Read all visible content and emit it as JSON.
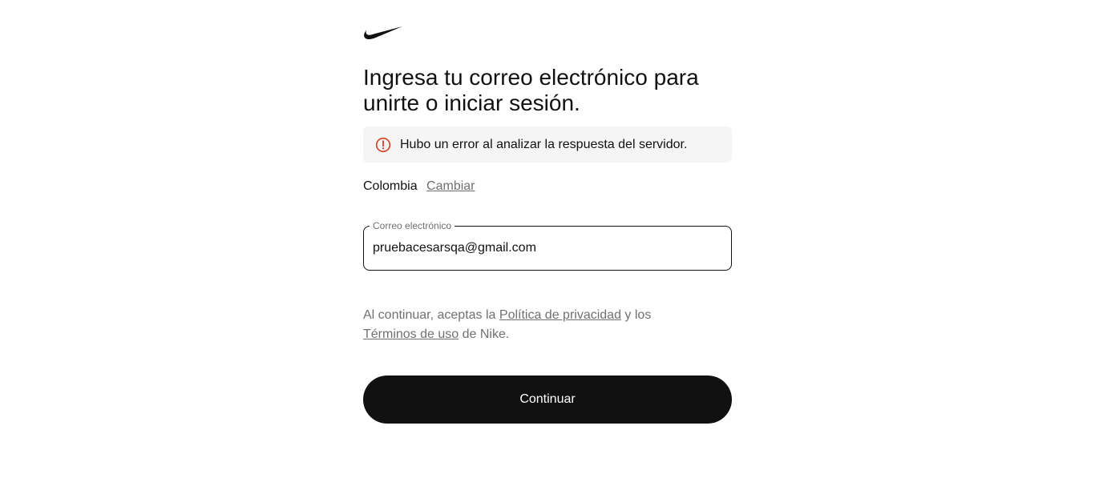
{
  "brand": {
    "logo_icon": "nike-swoosh-icon"
  },
  "heading": {
    "line1": "Ingresa tu correo electrónico para",
    "line2": "unirte o iniciar sesión."
  },
  "error": {
    "icon": "exclamation-circle-icon",
    "icon_color": "#d43f21",
    "message": "Hubo un error al analizar la respuesta del servidor."
  },
  "country": {
    "name": "Colombia",
    "change_label": "Cambiar"
  },
  "email_field": {
    "label": "Correo electrónico",
    "value": "pruebacesarsqa@gmail.com"
  },
  "legal": {
    "prefix": "Al continuar, aceptas la ",
    "privacy_link": "Política de privacidad",
    "middle": " y los",
    "terms_link": "Términos de uso",
    "suffix": " de Nike."
  },
  "actions": {
    "continue_label": "Continuar",
    "button_color": "#111111"
  }
}
